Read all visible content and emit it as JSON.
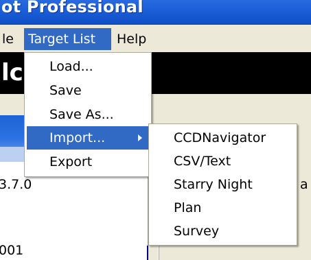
{
  "window": {
    "title_fragment": "ot Professional"
  },
  "menubar": {
    "items": [
      {
        "label": "le"
      },
      {
        "label": "Target List"
      },
      {
        "label": "Help"
      }
    ]
  },
  "background": {
    "logo_fragment": "lc",
    "version_fragment": "3.7.0",
    "id_fragment": "001",
    "right_fragment": "a"
  },
  "target_list_menu": {
    "items": [
      {
        "label": "Load..."
      },
      {
        "label": "Save"
      },
      {
        "label": "Save As..."
      },
      {
        "label": "Import...",
        "has_submenu": true,
        "highlighted": true
      },
      {
        "label": "Export"
      }
    ]
  },
  "import_submenu": {
    "items": [
      {
        "label": "CCDNavigator"
      },
      {
        "label": "CSV/Text"
      },
      {
        "label": "Starry Night"
      },
      {
        "label": "Plan"
      },
      {
        "label": "Survey"
      }
    ]
  },
  "colors": {
    "highlight": "#316ac5",
    "titlebar": "#1c5fd8",
    "menubar_bg": "#ece9d8"
  }
}
